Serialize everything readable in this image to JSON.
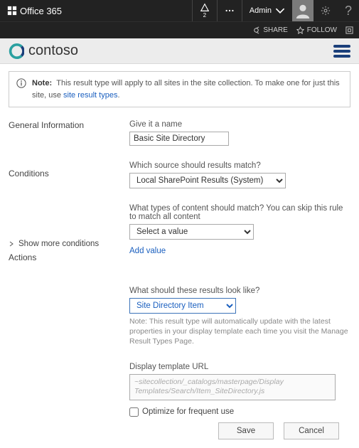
{
  "suite": {
    "brand": "Office 365",
    "notif_count": "2",
    "admin_label": "Admin",
    "share": "SHARE",
    "follow": "FOLLOW"
  },
  "site": {
    "name": "contoso"
  },
  "notice": {
    "label": "Note:",
    "text": "This result type will apply to all sites in the site collection. To make one for just this site, use ",
    "link": "site result types",
    "tail": "."
  },
  "sections": {
    "general": "General Information",
    "conditions": "Conditions",
    "show_more": "Show more conditions",
    "actions": "Actions"
  },
  "fields": {
    "name_label": "Give it a name",
    "name_value": "Basic Site Directory",
    "source_label": "Which source should results match?",
    "source_value": "Local SharePoint Results (System)",
    "types_label": "What types of content should match? You can skip this rule to match all content",
    "types_value": "Select a value",
    "add_value": "Add value",
    "look_label": "What should these results look like?",
    "look_value": "Site Directory Item",
    "look_hint": "Note: This result type will automatically update with the latest properties in your display template each time you visit the Manage Result Types Page.",
    "url_label": "Display template URL",
    "url_value": "~sitecollection/_catalogs/masterpage/Display Templates/Search/Item_SiteDirectory.js",
    "optimize": "Optimize for frequent use"
  },
  "buttons": {
    "save": "Save",
    "cancel": "Cancel"
  }
}
